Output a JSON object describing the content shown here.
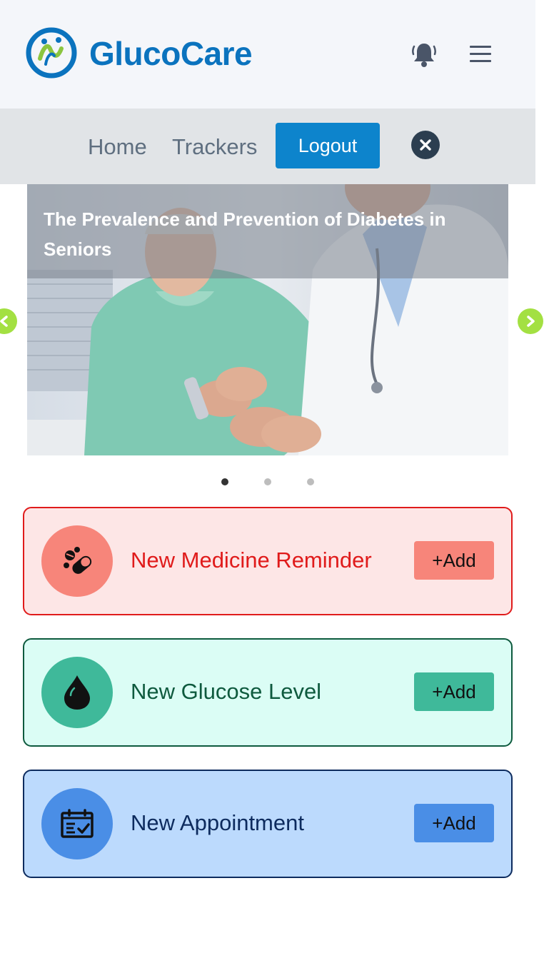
{
  "header": {
    "brand": "GlucoCare",
    "icons": {
      "logo": "glucocare-logo",
      "notifications": "bell-icon",
      "menu": "hamburger-menu-icon"
    }
  },
  "nav": {
    "links": [
      "Home",
      "Trackers"
    ],
    "logout_label": "Logout",
    "close_icon": "close-icon"
  },
  "carousel": {
    "caption": "The Prevalence and Prevention of Diabetes in Seniors",
    "slide_count": 3,
    "active_index": 0,
    "image": "doctor testing senior patient's blood glucose",
    "prev_icon": "chevron-left-icon",
    "next_icon": "chevron-right-icon"
  },
  "actions": [
    {
      "label": "New Medicine Reminder",
      "button": "+Add",
      "icon": "pills-icon",
      "colors": {
        "bg": "#fde6e6",
        "border": "#e01b1b",
        "circle": "#f7857a",
        "text": "#e01b1b",
        "button": "#f7857a"
      }
    },
    {
      "label": "New Glucose Level",
      "button": "+Add",
      "icon": "blood-drop-icon",
      "colors": {
        "bg": "#dbfdf5",
        "border": "#0e5a3e",
        "circle": "#3fb99a",
        "text": "#0e5a3e",
        "button": "#3fb99a"
      }
    },
    {
      "label": "New Appointment",
      "button": "+Add",
      "icon": "calendar-check-icon",
      "colors": {
        "bg": "#bcdafd",
        "border": "#0d2b5e",
        "circle": "#4a8ee6",
        "text": "#0d2b5e",
        "button": "#4a8ee6"
      }
    }
  ],
  "colors": {
    "brand": "#0b73be",
    "accent_green": "#a3e042",
    "logout": "#0d84cc"
  }
}
